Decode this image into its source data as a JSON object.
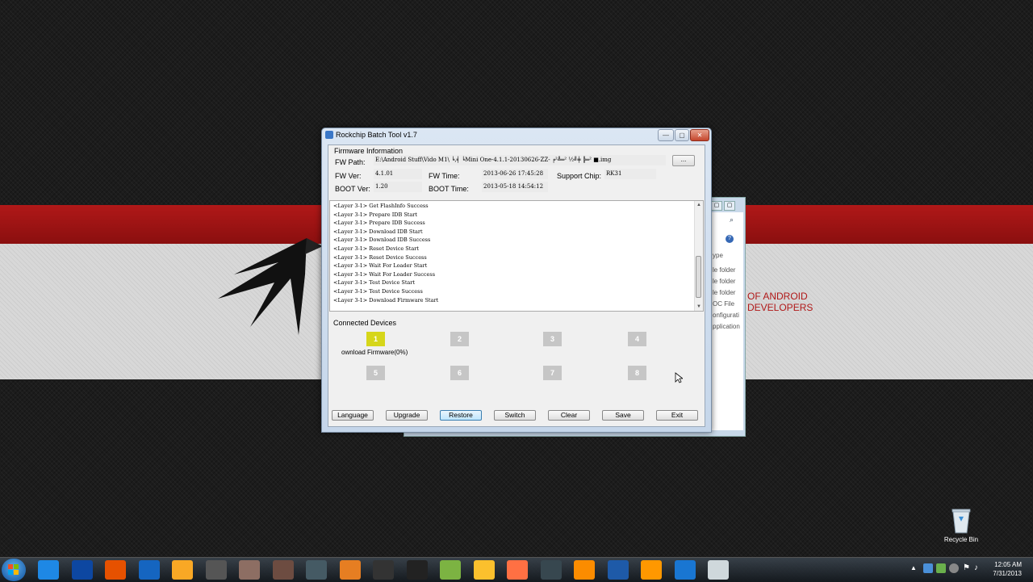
{
  "window": {
    "title": "Rockchip Batch Tool v1.7",
    "controls": {
      "minimize": "—",
      "maximize": "▢",
      "close": "✕"
    }
  },
  "firmware": {
    "group_label": "Firmware Information",
    "fw_path_label": "FW Path:",
    "fw_path_value": "E:\\Android Stuff\\Vido M1\\ ╘,╡ ╘Mini One-4.1.1-20130626-ZZ- ╒²╩═² ½╝╪ ╠═² ■.img",
    "browse_label": "...",
    "fw_ver_label": "FW Ver:",
    "fw_ver_value": "4.1.01",
    "fw_time_label": "FW Time:",
    "fw_time_value": "2013-06-26 17:45:28",
    "support_chip_label": "Support Chip:",
    "support_chip_value": "RK31",
    "boot_ver_label": "BOOT Ver:",
    "boot_ver_value": "1.20",
    "boot_time_label": "BOOT Time:",
    "boot_time_value": "2013-05-18 14:54:12"
  },
  "log": [
    "<Layer 3-1> Get FlashInfo Success",
    "<Layer 3-1> Prepare IDB Start",
    "<Layer 3-1> Prepare IDB Success",
    "<Layer 3-1> Download IDB Start",
    "<Layer 3-1> Download IDB Success",
    "<Layer 3-1> Reset Device Start",
    "<Layer 3-1> Reset Device Success",
    "<Layer 3-1> Wait For Loader Start",
    "<Layer 3-1> Wait For Loader Success",
    "<Layer 3-1> Test Device Start",
    "<Layer 3-1> Test Device Success",
    "<Layer 3-1> Download Firmware Start"
  ],
  "devices": {
    "group_label": "Connected Devices",
    "slots": [
      {
        "label": "1",
        "active": true
      },
      {
        "label": "2",
        "active": false
      },
      {
        "label": "3",
        "active": false
      },
      {
        "label": "4",
        "active": false
      },
      {
        "label": "5",
        "active": false
      },
      {
        "label": "6",
        "active": false
      },
      {
        "label": "7",
        "active": false
      },
      {
        "label": "8",
        "active": false
      }
    ],
    "status_1": "ownload Firmware(0%)",
    "active_color": "#d6d61a",
    "inactive_color": "#c6c6c6"
  },
  "buttons": {
    "language": "Language",
    "upgrade": "Upgrade",
    "restore": "Restore",
    "switch": "Switch",
    "clear": "Clear",
    "save": "Save",
    "exit": "Exit"
  },
  "background_window": {
    "rows": [
      "ype",
      "le folder",
      "le folder",
      "le folder",
      "OC File",
      "onfigurati",
      "pplication"
    ]
  },
  "wallpaper": {
    "line1": "OF ANDROID",
    "line2": "DEVELOPERS",
    "red": "#b01818"
  },
  "desktop": {
    "recycle_bin_label": "Recycle Bin"
  },
  "taskbar": {
    "icons": [
      "ie-icon",
      "maxthon-icon",
      "firefox-icon",
      "appstore-icon",
      "explorer-icon",
      "gamepad-icon",
      "league-icon",
      "diablo-icon",
      "starcraft-icon",
      "basketball-icon",
      "game-icon",
      "juventus-icon",
      "notepad-icon",
      "vlc-icon",
      "origin-icon",
      "steam-icon",
      "media-icon",
      "checklist-icon",
      "player-icon",
      "download-icon",
      "batchtool-icon"
    ],
    "time": "12:05 AM",
    "date": "7/31/2013"
  }
}
